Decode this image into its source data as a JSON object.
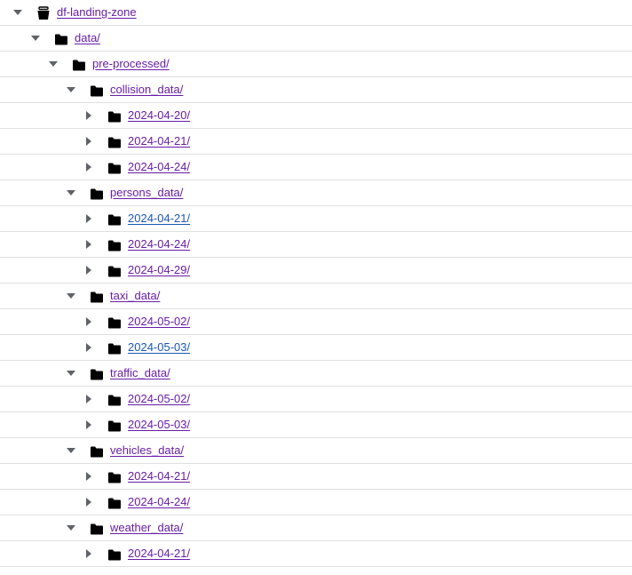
{
  "colors": {
    "visited_link": "#681da8",
    "unvisited_link": "#1a57b6",
    "row_divider": "#e0e0e0",
    "icon": "#000000",
    "toggle": "#5f6368"
  },
  "tree": {
    "nodes": [
      {
        "label": "df-landing-zone",
        "icon": "bucket-icon",
        "expanded": true,
        "visited": true
      },
      {
        "label": "data/",
        "icon": "folder-icon",
        "expanded": true,
        "visited": true
      },
      {
        "label": "pre-processed/",
        "icon": "folder-icon",
        "expanded": true,
        "visited": true
      },
      {
        "label": "collision_data/",
        "icon": "folder-icon",
        "expanded": true,
        "visited": true
      },
      {
        "label": "2024-04-20/",
        "icon": "folder-icon",
        "expanded": false,
        "visited": true
      },
      {
        "label": "2024-04-21/",
        "icon": "folder-icon",
        "expanded": false,
        "visited": true
      },
      {
        "label": "2024-04-24/",
        "icon": "folder-icon",
        "expanded": false,
        "visited": true
      },
      {
        "label": "persons_data/",
        "icon": "folder-icon",
        "expanded": true,
        "visited": true
      },
      {
        "label": "2024-04-21/",
        "icon": "folder-icon",
        "expanded": false,
        "visited": false
      },
      {
        "label": "2024-04-24/",
        "icon": "folder-icon",
        "expanded": false,
        "visited": true
      },
      {
        "label": "2024-04-29/",
        "icon": "folder-icon",
        "expanded": false,
        "visited": true
      },
      {
        "label": "taxi_data/",
        "icon": "folder-icon",
        "expanded": true,
        "visited": true
      },
      {
        "label": "2024-05-02/",
        "icon": "folder-icon",
        "expanded": false,
        "visited": true
      },
      {
        "label": "2024-05-03/",
        "icon": "folder-icon",
        "expanded": false,
        "visited": false
      },
      {
        "label": "traffic_data/",
        "icon": "folder-icon",
        "expanded": true,
        "visited": true
      },
      {
        "label": "2024-05-02/",
        "icon": "folder-icon",
        "expanded": false,
        "visited": true
      },
      {
        "label": "2024-05-03/",
        "icon": "folder-icon",
        "expanded": false,
        "visited": true
      },
      {
        "label": "vehicles_data/",
        "icon": "folder-icon",
        "expanded": true,
        "visited": true
      },
      {
        "label": "2024-04-21/",
        "icon": "folder-icon",
        "expanded": false,
        "visited": true
      },
      {
        "label": "2024-04-24/",
        "icon": "folder-icon",
        "expanded": false,
        "visited": true
      },
      {
        "label": "weather_data/",
        "icon": "folder-icon",
        "expanded": true,
        "visited": true
      },
      {
        "label": "2024-04-21/",
        "icon": "folder-icon",
        "expanded": false,
        "visited": true
      }
    ]
  }
}
